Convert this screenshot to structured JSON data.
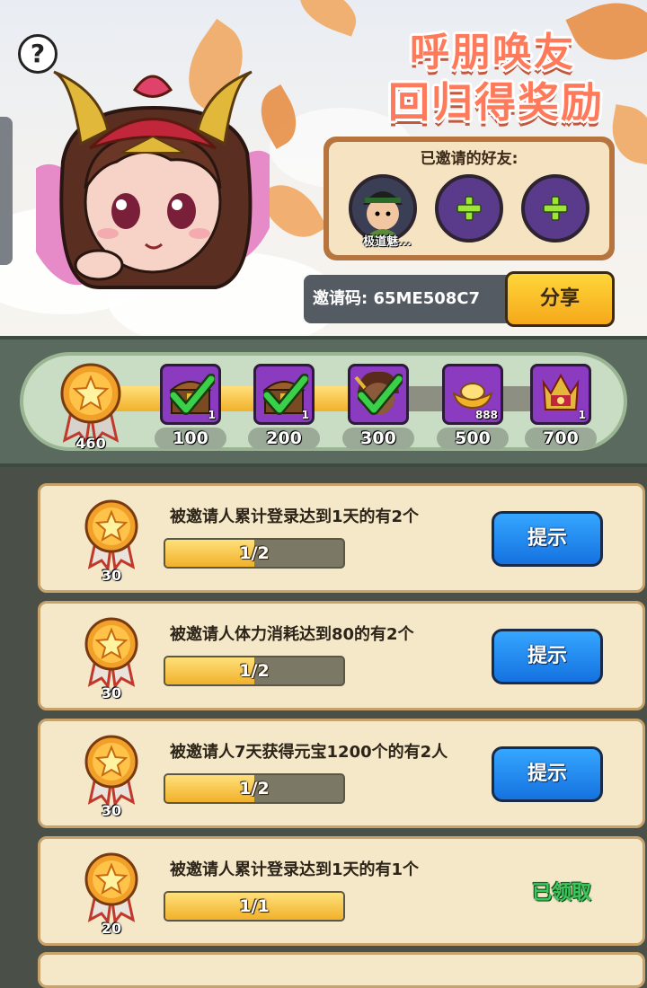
{
  "banner": {
    "help_icon": "?",
    "title_line1": "呼朋唤友",
    "title_line2": "回归得奖励"
  },
  "friends": {
    "label": "已邀请的好友:",
    "invited": [
      {
        "name": "极道魅..."
      }
    ],
    "empty_slots": 2
  },
  "invite": {
    "code_text": "邀请码: 65ME508C7",
    "share_label": "分享"
  },
  "progress": {
    "current_points": "460",
    "fraction": 0.6,
    "milestones": [
      {
        "points": "100",
        "count": "1",
        "claimed": true,
        "item": "chest"
      },
      {
        "points": "200",
        "count": "1",
        "claimed": true,
        "item": "chest"
      },
      {
        "points": "300",
        "count": "",
        "claimed": true,
        "item": "hero-portrait"
      },
      {
        "points": "500",
        "count": "888",
        "claimed": false,
        "item": "gold-ingot"
      },
      {
        "points": "700",
        "count": "1",
        "claimed": false,
        "item": "crown-emblem"
      }
    ]
  },
  "tasks": [
    {
      "reward": "30",
      "desc": "被邀请人累计登录达到1天的有2个",
      "progress_text": "1/2",
      "fraction": 0.5,
      "action": "提示",
      "done": false
    },
    {
      "reward": "30",
      "desc": "被邀请人体力消耗达到80的有2个",
      "progress_text": "1/2",
      "fraction": 0.5,
      "action": "提示",
      "done": false
    },
    {
      "reward": "30",
      "desc": "被邀请人7天获得元宝1200个的有2人",
      "progress_text": "1/2",
      "fraction": 0.5,
      "action": "提示",
      "done": false
    },
    {
      "reward": "20",
      "desc": "被邀请人累计登录达到1天的有1个",
      "progress_text": "1/1",
      "fraction": 1.0,
      "action": "已领取",
      "done": true
    }
  ],
  "colors": {
    "title": "#ff7a5a",
    "hint_button": "#1f8cf0",
    "share_button": "#f5b51f",
    "claimed_text": "#3cc85a",
    "milestone_box": "#8a3bc0",
    "progress_fill": "#f1b12a"
  }
}
